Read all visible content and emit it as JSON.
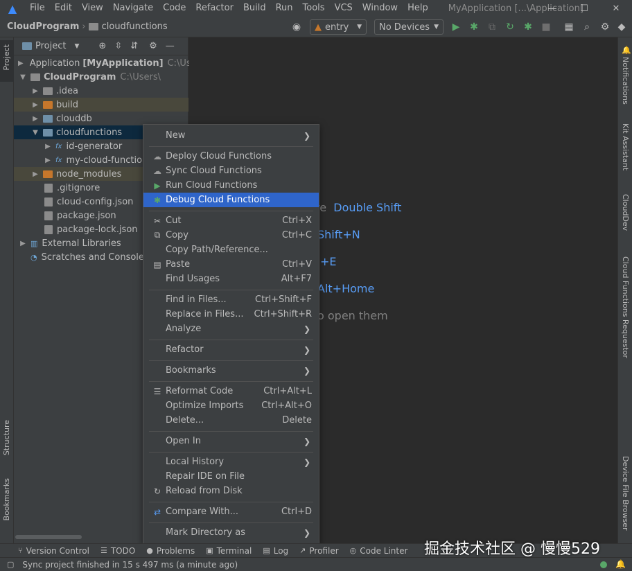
{
  "menubar": {
    "items": [
      "File",
      "Edit",
      "View",
      "Navigate",
      "Code",
      "Refactor",
      "Build",
      "Run",
      "Tools",
      "VCS",
      "Window",
      "Help"
    ],
    "window_title": "MyApplication [...\\Application]"
  },
  "navbar": {
    "crumb_project": "CloudProgram",
    "crumb_folder": "cloudfunctions",
    "module_combo": "entry",
    "device_combo": "No Devices"
  },
  "left_strip": {
    "project_tab": "Project",
    "structure_tab": "Structure",
    "bookmarks_tab": "Bookmarks"
  },
  "right_strip": {
    "notifications": "Notifications",
    "kit_assistant": "Kit Assistant",
    "clouddev": "CloudDev",
    "cloud_functions_requestor": "Cloud Functions Requestor",
    "device_file_browser": "Device File Browser"
  },
  "project_panel": {
    "title": "Project",
    "tree": [
      {
        "label": "Application",
        "bold": "[MyApplication]",
        "path": "C:\\Use"
      },
      {
        "label": "CloudProgram",
        "path": "C:\\Users\\"
      },
      {
        "label": ".idea"
      },
      {
        "label": "build"
      },
      {
        "label": "clouddb"
      },
      {
        "label": "cloudfunctions"
      },
      {
        "label": "id-generator"
      },
      {
        "label": "my-cloud-function"
      },
      {
        "label": "node_modules"
      },
      {
        "label": ".gitignore"
      },
      {
        "label": "cloud-config.json"
      },
      {
        "label": "package.json"
      },
      {
        "label": "package-lock.json"
      },
      {
        "label": "External Libraries"
      },
      {
        "label": "Scratches and Consoles"
      }
    ]
  },
  "editor_hints": {
    "h1_text": "re",
    "h1_key": "Double Shift",
    "h2_key": "Shift+N",
    "h3_key": "+E",
    "h4_key": "Alt+Home",
    "h5_text": "o open them"
  },
  "context_menu": {
    "new": "New",
    "deploy": "Deploy Cloud Functions",
    "sync": "Sync Cloud Functions",
    "run": "Run Cloud Functions",
    "debug": "Debug Cloud Functions",
    "cut": "Cut",
    "cut_sc": "Ctrl+X",
    "copy": "Copy",
    "copy_sc": "Ctrl+C",
    "copy_path": "Copy Path/Reference...",
    "paste": "Paste",
    "paste_sc": "Ctrl+V",
    "find_usages": "Find Usages",
    "find_usages_sc": "Alt+F7",
    "find_in_files": "Find in Files...",
    "find_in_files_sc": "Ctrl+Shift+F",
    "replace_in_files": "Replace in Files...",
    "replace_in_files_sc": "Ctrl+Shift+R",
    "analyze": "Analyze",
    "refactor": "Refactor",
    "bookmarks": "Bookmarks",
    "reformat": "Reformat Code",
    "reformat_sc": "Ctrl+Alt+L",
    "optimize": "Optimize Imports",
    "optimize_sc": "Ctrl+Alt+O",
    "delete": "Delete...",
    "delete_sc": "Delete",
    "open_in": "Open In",
    "local_history": "Local History",
    "repair": "Repair IDE on File",
    "reload": "Reload from Disk",
    "compare": "Compare With...",
    "compare_sc": "Ctrl+D",
    "mark_dir": "Mark Directory as"
  },
  "bottom_tabs": [
    "Version Control",
    "TODO",
    "Problems",
    "Terminal",
    "Log",
    "Profiler",
    "Code Linter"
  ],
  "status": {
    "message": "Sync project finished in 15 s 497 ms (a minute ago)"
  },
  "watermark": "掘金技术社区 @ 慢慢529"
}
